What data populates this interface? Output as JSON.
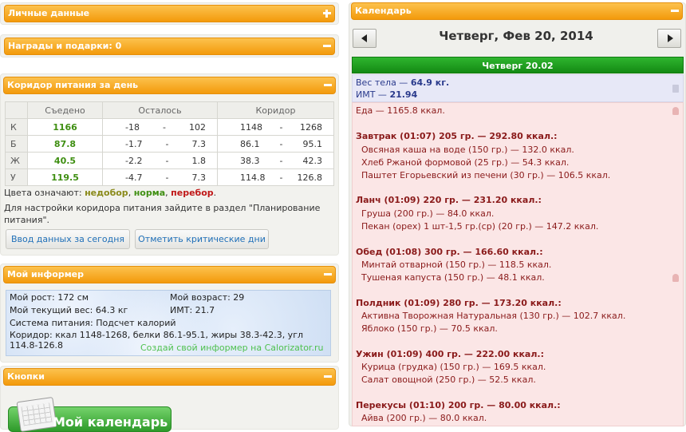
{
  "left": {
    "personal": {
      "title": "Личные данные"
    },
    "awards": {
      "title": "Награды и подарки: 0"
    },
    "corridor": {
      "title": "Коридор питания за день",
      "headers": [
        "Съедено",
        "Осталось",
        "Коридор"
      ],
      "rows": [
        {
          "label": "К",
          "eaten": "1166",
          "rem_a": "-18",
          "rem_sep": "-",
          "rem_b": "102",
          "cor_a": "1148",
          "cor_sep": "-",
          "cor_b": "1268"
        },
        {
          "label": "Б",
          "eaten": "87.8",
          "rem_a": "-1.7",
          "rem_sep": "-",
          "rem_b": "7.3",
          "cor_a": "86.1",
          "cor_sep": "-",
          "cor_b": "95.1"
        },
        {
          "label": "Ж",
          "eaten": "40.5",
          "rem_a": "-2.2",
          "rem_sep": "-",
          "rem_b": "1.8",
          "cor_a": "38.3",
          "cor_sep": "-",
          "cor_b": "42.3"
        },
        {
          "label": "У",
          "eaten": "119.5",
          "rem_a": "-4.7",
          "rem_sep": "-",
          "rem_b": "7.3",
          "cor_a": "114.8",
          "cor_sep": "-",
          "cor_b": "126.8"
        }
      ],
      "legend_prefix": "Цвета означают:",
      "legend_under": "недобор",
      "legend_sep1": ",",
      "legend_norm": "норма",
      "legend_sep2": ",",
      "legend_over": "перебор",
      "legend_end": ".",
      "hint_line1": "Для настройки коридора питания зайдите в раздел \"Планирование",
      "hint_line2": "питания\".",
      "btn_today": "Ввод данных за сегодня",
      "btn_critical": "Отметить критические дни",
      "colors": {
        "under": "#8a8a1a",
        "norm": "#3f8f12",
        "over": "#c01818"
      }
    },
    "informer": {
      "title": "Мой информер",
      "height": "Мой рост: 172 см",
      "age": "Мой возраст: 29",
      "weight": "Мой текущий вес: 64.3 кг",
      "bmi": "ИМТ: 21.7",
      "system": "Система питания: Подсчет калорий",
      "corridor": "Коридор: ккал 1148-1268, белки 86.1-95.1, жиры 38.3-42.3, угл 114.8-126.8",
      "link": "Создай свой информер на Calorizator.ru"
    },
    "buttons": {
      "title": "Кнопки",
      "my_calendar": "Мой календарь"
    }
  },
  "calendar": {
    "title": "Календарь",
    "date_heading": "Четверг, Фев 20, 2014",
    "day_bar": "Четверг 20.02",
    "body": {
      "weight_prefix": "Вес тела —",
      "weight": "64.9 кг.",
      "bmi_prefix": "ИМТ —",
      "bmi": "21.94"
    },
    "food_total": "Еда — 1165.8 ккал.",
    "meals": [
      {
        "header": "Завтрак (01:07) 205 гр. — 292.80 ккал.:",
        "items": [
          "Овсяная каша на воде (150 гр.) — 132.0 ккал.",
          "Хлеб Ржаной формовой (25 гр.) — 54.3 ккал.",
          "Паштет Егорьевский из печени (30 гр.) — 106.5 ккал."
        ]
      },
      {
        "header": "Ланч (01:09) 220 гр. — 231.20 ккал.:",
        "items": [
          "Груша (200 гр.) — 84.0 ккал.",
          "Пекан (орех) 1 шт-1,5 гр.(ср) (20 гр.) — 147.2 ккал."
        ]
      },
      {
        "header": "Обед (01:08) 300 гр. — 166.60 ккал.:",
        "items": [
          "Минтай отварной (150 гр.) — 118.5 ккал.",
          "Тушеная капуста (150 гр.) — 48.1 ккал."
        ]
      },
      {
        "header": "Полдник (01:09) 280 гр. — 173.20 ккал.:",
        "items": [
          "Активна Творожная Натуральная (130 гр.) — 102.7 ккал.",
          "Яблоко (150 гр.) — 70.5 ккал."
        ]
      },
      {
        "header": "Ужин (01:09) 400 гр. — 222.00 ккал.:",
        "items": [
          "Курица (грудка) (150 гр.) — 169.5 ккал.",
          "Салат овощной (250 гр.) — 52.5 ккал."
        ]
      },
      {
        "header": "Перекусы (01:10) 200 гр. — 80.00 ккал.:",
        "items": [
          "Айва (200 гр.) — 80.0 ккал."
        ]
      }
    ]
  }
}
